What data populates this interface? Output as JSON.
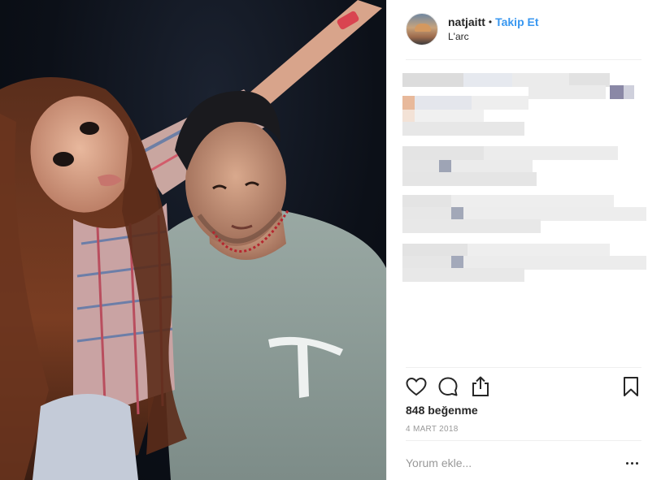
{
  "post": {
    "username": "natjaitt",
    "separator": "•",
    "follow_label": "Takip Et",
    "location": "L'arc",
    "likes_text": "848 beğenme",
    "date": "4 MART 2018",
    "comment_placeholder": "Yorum ekle..."
  },
  "icons": {
    "like": "heart-icon",
    "comment": "comment-bubble-icon",
    "share": "share-icon",
    "save": "bookmark-icon",
    "more": "more-options-icon"
  },
  "colors": {
    "accent": "#3897f0",
    "text": "#262626",
    "muted": "#999999",
    "divider": "#efefef"
  }
}
